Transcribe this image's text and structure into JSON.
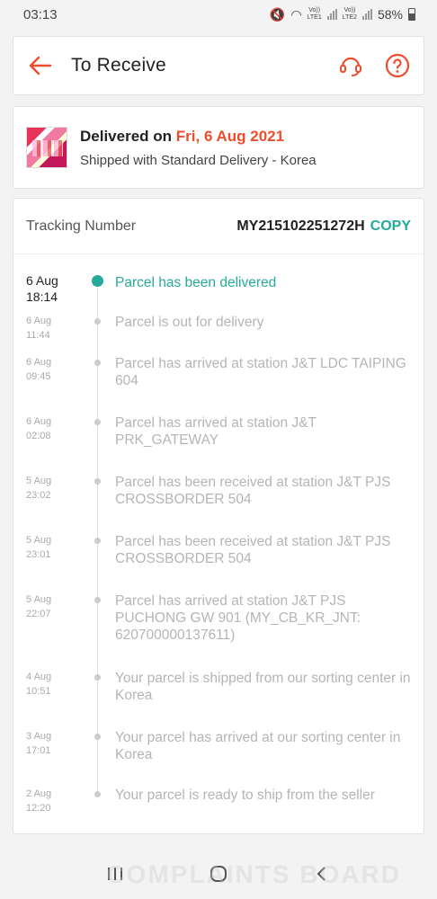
{
  "status_bar": {
    "time": "03:13",
    "lte1": "Vo)) LTE1",
    "lte2": "Vo)) LTE2",
    "battery": "58%"
  },
  "header": {
    "title": "To Receive",
    "icons": [
      "back-arrow-icon",
      "customer-service-icon",
      "help-icon"
    ]
  },
  "delivery": {
    "prefix": "Delivered on",
    "date": "Fri, 6 Aug 2021",
    "shipped_with": "Shipped with Standard Delivery - Korea"
  },
  "tracking": {
    "label": "Tracking Number",
    "number": "MY215102251272H",
    "copy_label": "COPY",
    "events": [
      {
        "date": "6 Aug",
        "time": "18:14",
        "desc": "Parcel has been delivered"
      },
      {
        "date": "6 Aug",
        "time": "11:44",
        "desc": "Parcel is out for delivery"
      },
      {
        "date": "6 Aug",
        "time": "09:45",
        "desc": "Parcel has arrived at station J&T LDC TAIPING 604"
      },
      {
        "date": "6 Aug",
        "time": "02:08",
        "desc": "Parcel has arrived at station J&T PRK_GATEWAY"
      },
      {
        "date": "5 Aug",
        "time": "23:02",
        "desc": "Parcel has been received at station J&T PJS CROSSBORDER 504"
      },
      {
        "date": "5 Aug",
        "time": "23:01",
        "desc": "Parcel has been received at station J&T PJS CROSSBORDER 504"
      },
      {
        "date": "5 Aug",
        "time": "22:07",
        "desc": "Parcel has arrived at station J&T PJS PUCHONG GW 901 (MY_CB_KR_JNT: 620700000137611)"
      },
      {
        "date": "4 Aug",
        "time": "10:51",
        "desc": "Your parcel is shipped from our sorting center in Korea"
      },
      {
        "date": "3 Aug",
        "time": "17:01",
        "desc": "Your parcel has arrived at our sorting center in Korea"
      },
      {
        "date": "2 Aug",
        "time": "12:20",
        "desc": "Your parcel is ready to ship from the seller"
      }
    ]
  },
  "colors": {
    "accent": "#ee4d2d",
    "teal": "#26aa99"
  },
  "watermark": "COMPLAINTS BOARD"
}
